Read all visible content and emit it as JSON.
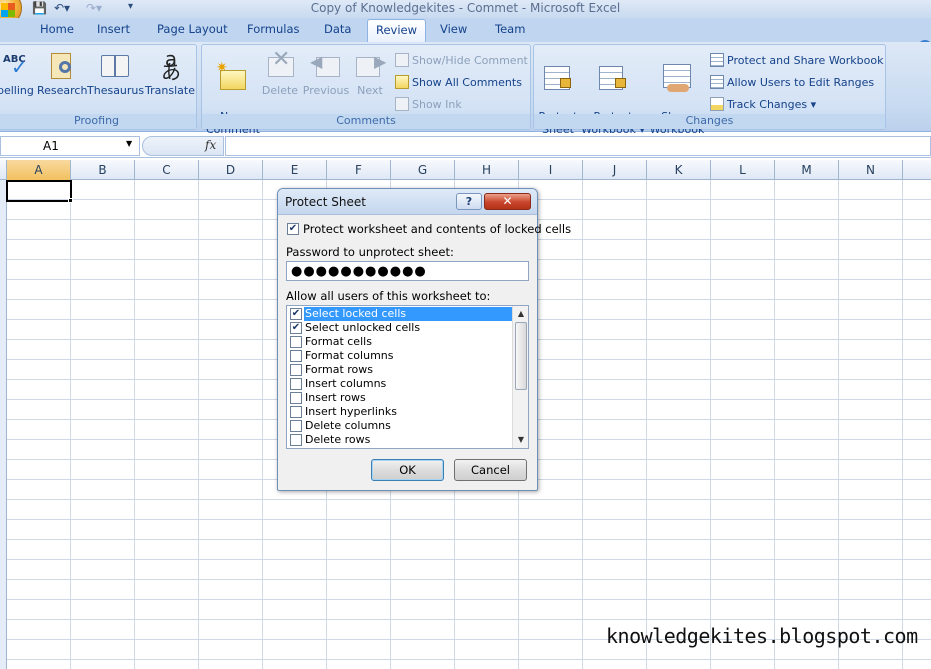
{
  "window": {
    "title": "Copy of Knowledgekites - Commet - Microsoft Excel"
  },
  "tabs": [
    "Home",
    "Insert",
    "Page Layout",
    "Formulas",
    "Data",
    "Review",
    "View",
    "Team"
  ],
  "active_tab": "Review",
  "ribbon": {
    "proofing": {
      "label": "Proofing",
      "buttons": [
        "pelling",
        "Research",
        "Thesaurus",
        "Translate"
      ],
      "spelling_icon_text": "ABC",
      "translate_icon_text": "aあ"
    },
    "comments": {
      "label": "Comments",
      "new_comment": "New\nComment",
      "delete": "Delete",
      "previous": "Previous",
      "next": "Next",
      "show_hide": "Show/Hide Comment",
      "show_all": "Show All Comments",
      "show_ink": "Show Ink"
    },
    "changes": {
      "label": "Changes",
      "protect_sheet": "Protect\nSheet",
      "protect_workbook": "Protect\nWorkbook ▾",
      "share_workbook": "Share\nWorkbook",
      "protect_share": "Protect and Share Workbook",
      "allow_users": "Allow Users to Edit Ranges",
      "track_changes": "Track Changes ▾"
    }
  },
  "formula_bar": {
    "name_box": "A1",
    "fx": "fx",
    "value": ""
  },
  "columns": [
    "A",
    "B",
    "C",
    "D",
    "E",
    "F",
    "G",
    "H",
    "I",
    "J",
    "K",
    "L",
    "M",
    "N"
  ],
  "selected_column": "A",
  "dialog": {
    "title": "Protect Sheet",
    "help": "?",
    "close": "✕",
    "protect_checkbox_label": "Protect worksheet and contents of locked cells",
    "protect_checked": true,
    "password_label": "Password to unprotect sheet:",
    "password_value": "●●●●●●●●●●●",
    "allow_label": "Allow all users of this worksheet to:",
    "permissions": [
      {
        "label": "Select locked cells",
        "checked": true,
        "selected": true
      },
      {
        "label": "Select unlocked cells",
        "checked": true,
        "selected": false
      },
      {
        "label": "Format cells",
        "checked": false,
        "selected": false
      },
      {
        "label": "Format columns",
        "checked": false,
        "selected": false
      },
      {
        "label": "Format rows",
        "checked": false,
        "selected": false
      },
      {
        "label": "Insert columns",
        "checked": false,
        "selected": false
      },
      {
        "label": "Insert rows",
        "checked": false,
        "selected": false
      },
      {
        "label": "Insert hyperlinks",
        "checked": false,
        "selected": false
      },
      {
        "label": "Delete columns",
        "checked": false,
        "selected": false
      },
      {
        "label": "Delete rows",
        "checked": false,
        "selected": false
      }
    ],
    "ok": "OK",
    "cancel": "Cancel"
  },
  "watermark": "knowledgekites.blogspot.com"
}
